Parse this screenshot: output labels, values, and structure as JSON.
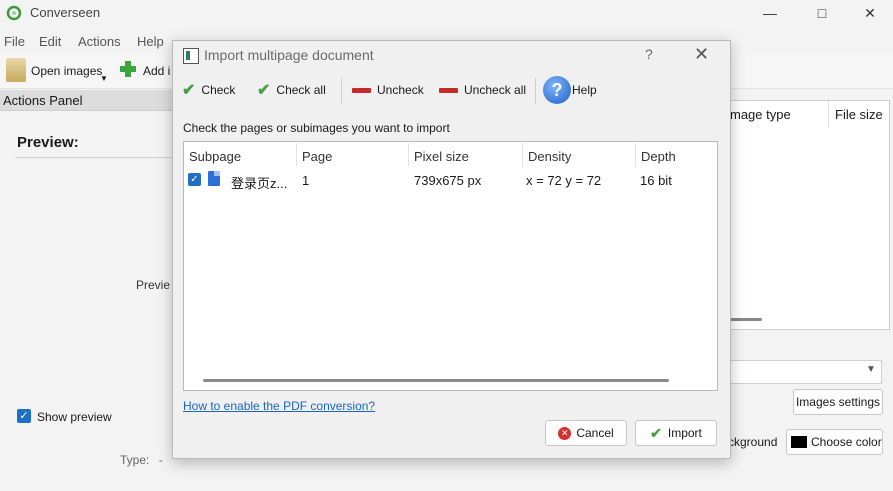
{
  "app": {
    "title": "Converseen"
  },
  "menu": [
    "File",
    "Edit",
    "Actions",
    "Help"
  ],
  "toolbar": {
    "open_images": "Open images",
    "add_images": "Add i"
  },
  "actions_panel": {
    "title": "Actions Panel",
    "preview_label": "Preview:",
    "preview_caption": "Previe",
    "show_preview": "Show preview",
    "type_label": "Type:",
    "type_value": "-"
  },
  "right_panel": {
    "col_image_type": "mage type",
    "col_file_size": "File size",
    "images_settings": "Images settings",
    "background_label": "ckground",
    "choose_color": "Choose color"
  },
  "dialog": {
    "title": "Import multipage document",
    "help_q": "?",
    "close": "✕",
    "toolbar": {
      "check": "Check",
      "check_all": "Check all",
      "uncheck": "Uncheck",
      "uncheck_all": "Uncheck all",
      "help": "Help"
    },
    "instruction": "Check the pages or subimages you want to import",
    "table": {
      "headers": [
        "Subpage",
        "Page",
        "Pixel size",
        "Density",
        "Depth"
      ],
      "rows": [
        {
          "subpage": "登录页z...",
          "page": "1",
          "pixel_size": "739x675 px",
          "density": "x = 72 y = 72",
          "depth": "16 bit",
          "checked": true
        }
      ]
    },
    "pdf_link": "How to enable the PDF conversion?",
    "cancel": "Cancel",
    "import": "Import"
  },
  "colors": {
    "accent": "#1f6fc5",
    "check_green": "#4aa043",
    "uncheck_red": "#c42a2a",
    "link": "#1a66c7"
  }
}
